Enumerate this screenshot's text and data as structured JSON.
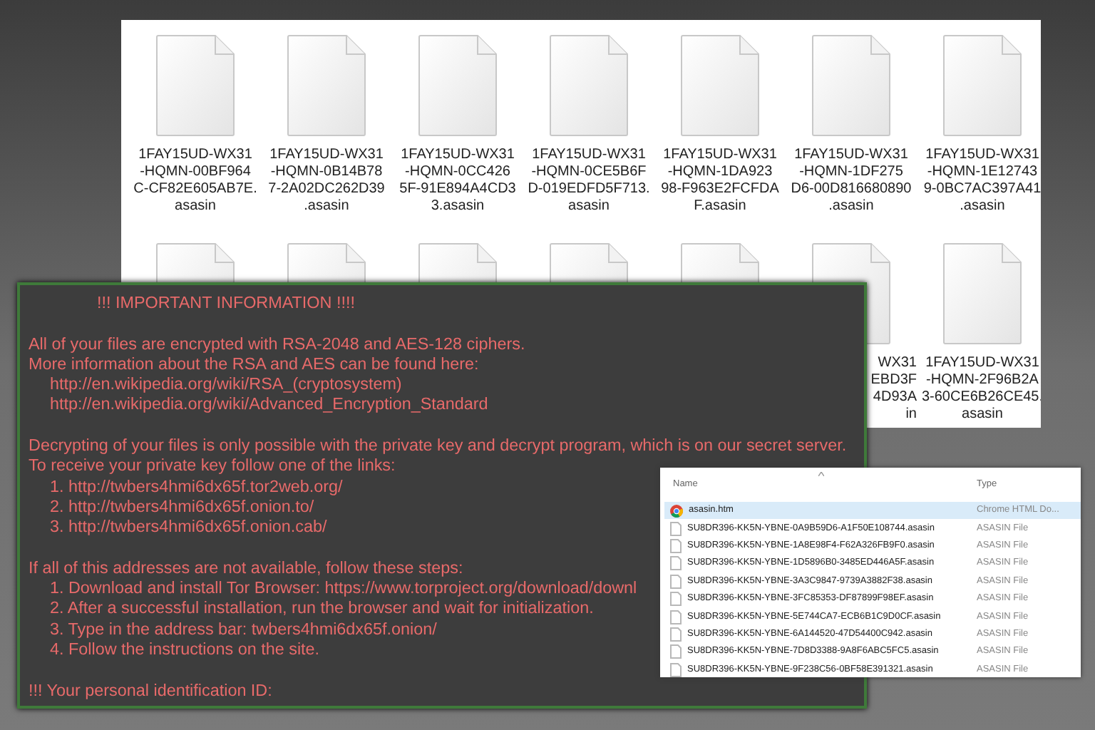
{
  "explorer": {
    "files": [
      {
        "name_lines": [
          "1FAY15UD-WX31",
          "-HQMN-00BF964",
          "C-CF82E605AB7E.",
          "asasin"
        ]
      },
      {
        "name_lines": [
          "1FAY15UD-WX31",
          "-HQMN-0B14B78",
          "7-2A02DC262D39",
          ".asasin"
        ]
      },
      {
        "name_lines": [
          "1FAY15UD-WX31",
          "-HQMN-0CC426",
          "5F-91E894A4CD3",
          "3.asasin"
        ]
      },
      {
        "name_lines": [
          "1FAY15UD-WX31",
          "-HQMN-0CE5B6F",
          "D-019EDFD5F713.",
          "asasin"
        ]
      },
      {
        "name_lines": [
          "1FAY15UD-WX31",
          "-HQMN-1DA923",
          "98-F963E2FCFDA",
          "F.asasin"
        ]
      },
      {
        "name_lines": [
          "1FAY15UD-WX31",
          "-HQMN-1DF275",
          "D6-00D816680890",
          ".asasin"
        ]
      },
      {
        "name_lines": [
          "1FAY15UD-WX31",
          "-HQMN-1E12743",
          "9-0BC7AC397A41",
          ".asasin"
        ]
      },
      {
        "kind": "unlabeled"
      },
      {
        "kind": "unlabeled"
      },
      {
        "kind": "unlabeled"
      },
      {
        "kind": "unlabeled"
      },
      {
        "kind": "unlabeled"
      },
      {
        "name_lines": [
          "WX31",
          "EBD3F",
          "4D93A",
          "in"
        ]
      },
      {
        "name_lines": [
          "1FAY15UD-WX31",
          "-HQMN-2F96B2A",
          "3-60CE6B26CE45.",
          "asasin"
        ]
      }
    ]
  },
  "note": {
    "title": "!!! IMPORTANT INFORMATION !!!!",
    "paragraphs": [
      {
        "lines": [
          {
            "kind": "text",
            "text": "All of your files are encrypted with RSA-2048 and AES-128 ciphers."
          },
          {
            "kind": "text",
            "text": "More information about the RSA and AES can be found here:"
          },
          {
            "kind": "item",
            "text": "http://en.wikipedia.org/wiki/RSA_(cryptosystem)"
          },
          {
            "kind": "item",
            "text": "http://en.wikipedia.org/wiki/Advanced_Encryption_Standard"
          }
        ]
      },
      {
        "lines": [
          {
            "kind": "text",
            "text": "Decrypting of your files is only possible with the private key and decrypt program, which is on our secret server."
          },
          {
            "kind": "text",
            "text": "To receive your private key follow one of the links:"
          },
          {
            "kind": "item",
            "text": "1. http://twbers4hmi6dx65f.tor2web.org/"
          },
          {
            "kind": "item",
            "text": "2. http://twbers4hmi6dx65f.onion.to/"
          },
          {
            "kind": "item",
            "text": "3. http://twbers4hmi6dx65f.onion.cab/"
          }
        ]
      },
      {
        "lines": [
          {
            "kind": "text",
            "text": "If all of this addresses are not available, follow these steps:"
          },
          {
            "kind": "item",
            "text": "1. Download and install Tor Browser: https://www.torproject.org/download/downl"
          },
          {
            "kind": "item",
            "text": "2. After a successful installation, run the browser and wait for initialization."
          },
          {
            "kind": "item",
            "text": "3. Type in the address bar: twbers4hmi6dx65f.onion/"
          },
          {
            "kind": "item",
            "text": "4. Follow the instructions on the site."
          }
        ]
      },
      {
        "lines": [
          {
            "kind": "text",
            "text": "!!! Your personal identification ID:"
          }
        ]
      }
    ]
  },
  "file_list": {
    "columns": [
      "Name",
      "Type"
    ],
    "rows": [
      {
        "kind": "htm",
        "name": "asasin.htm",
        "type": "Chrome HTML Do...",
        "selected": true
      },
      {
        "kind": "file",
        "name": "SU8DR396-KK5N-YBNE-0A9B59D6-A1F50E108744.asasin",
        "type": "ASASIN File",
        "selected": false
      },
      {
        "kind": "file",
        "name": "SU8DR396-KK5N-YBNE-1A8E98F4-F62A326FB9F0.asasin",
        "type": "ASASIN File",
        "selected": false
      },
      {
        "kind": "file",
        "name": "SU8DR396-KK5N-YBNE-1D5896B0-3485ED446A5F.asasin",
        "type": "ASASIN File",
        "selected": false
      },
      {
        "kind": "file",
        "name": "SU8DR396-KK5N-YBNE-3A3C9847-9739A3882F38.asasin",
        "type": "ASASIN File",
        "selected": false
      },
      {
        "kind": "file",
        "name": "SU8DR396-KK5N-YBNE-3FC85353-DF87899F98EF.asasin",
        "type": "ASASIN File",
        "selected": false
      },
      {
        "kind": "file",
        "name": "SU8DR396-KK5N-YBNE-5E744CA7-ECB6B1C9D0CF.asasin",
        "type": "ASASIN File",
        "selected": false
      },
      {
        "kind": "file",
        "name": "SU8DR396-KK5N-YBNE-6A144520-47D54400C942.asasin",
        "type": "ASASIN File",
        "selected": false
      },
      {
        "kind": "file",
        "name": "SU8DR396-KK5N-YBNE-7D8D3388-9A8F6ABC5FC5.asasin",
        "type": "ASASIN File",
        "selected": false
      },
      {
        "kind": "file",
        "name": "SU8DR396-KK5N-YBNE-9F238C56-0BF58E391321.asasin",
        "type": "ASASIN File",
        "selected": false
      }
    ]
  }
}
